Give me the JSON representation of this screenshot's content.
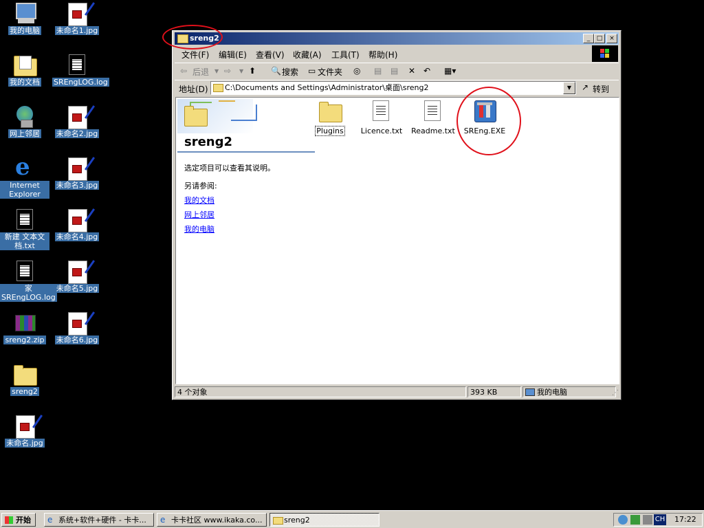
{
  "desktop": {
    "icons_left": [
      {
        "label": "我的电脑",
        "type": "computer"
      },
      {
        "label": "我的文档",
        "type": "docs"
      },
      {
        "label": "网上邻居",
        "type": "network"
      },
      {
        "label": "Internet Explorer",
        "type": "ie"
      },
      {
        "label": "新建 文本文档.txt",
        "type": "txt"
      },
      {
        "label": "家 SREngLOG.log",
        "type": "txt"
      },
      {
        "label": "sreng2.zip",
        "type": "zip"
      },
      {
        "label": "sreng2",
        "type": "folder"
      },
      {
        "label": "未命名.jpg",
        "type": "jpg"
      }
    ],
    "icons_right": [
      {
        "label": "未命名1.jpg",
        "type": "jpg"
      },
      {
        "label": "SREngLOG.log",
        "type": "txt"
      },
      {
        "label": "未命名2.jpg",
        "type": "jpg"
      },
      {
        "label": "未命名3.jpg",
        "type": "jpg"
      },
      {
        "label": "未命名4.jpg",
        "type": "jpg"
      },
      {
        "label": "未命名5.jpg",
        "type": "jpg"
      },
      {
        "label": "未命名6.jpg",
        "type": "jpg"
      }
    ]
  },
  "window": {
    "title": "sreng2",
    "controls": {
      "minimize": "_",
      "maximize": "□",
      "close": "×"
    },
    "menu": [
      "文件(F)",
      "编辑(E)",
      "查看(V)",
      "收藏(A)",
      "工具(T)",
      "帮助(H)"
    ],
    "toolbar": {
      "back": "后退",
      "search": "搜索",
      "folders": "文件夹"
    },
    "address": {
      "label": "地址(D)",
      "value": "C:\\Documents and Settings\\Administrator\\桌面\\sreng2",
      "go": "转到"
    },
    "sidepanel": {
      "folder_name": "sreng2",
      "description": "选定项目可以查看其说明。",
      "see_also": "另请参阅:",
      "links": [
        "我的文档",
        "网上邻居",
        "我的电脑"
      ]
    },
    "files": [
      {
        "name": "Plugins",
        "type": "folder"
      },
      {
        "name": "Licence.txt",
        "type": "txt"
      },
      {
        "name": "Readme.txt",
        "type": "txt"
      },
      {
        "name": "SREng.EXE",
        "type": "exe"
      }
    ],
    "status": {
      "count": "4 个对象",
      "size": "393 KB",
      "location": "我的电脑"
    }
  },
  "taskbar": {
    "start": "开始",
    "buttons": [
      {
        "label": "系统+软件+硬件 - 卡卡...",
        "active": false
      },
      {
        "label": "卡卡社区 www.ikaka.co...",
        "active": false
      },
      {
        "label": "sreng2",
        "active": true
      }
    ],
    "tray": {
      "lang": "CH",
      "time": "17:22"
    }
  }
}
